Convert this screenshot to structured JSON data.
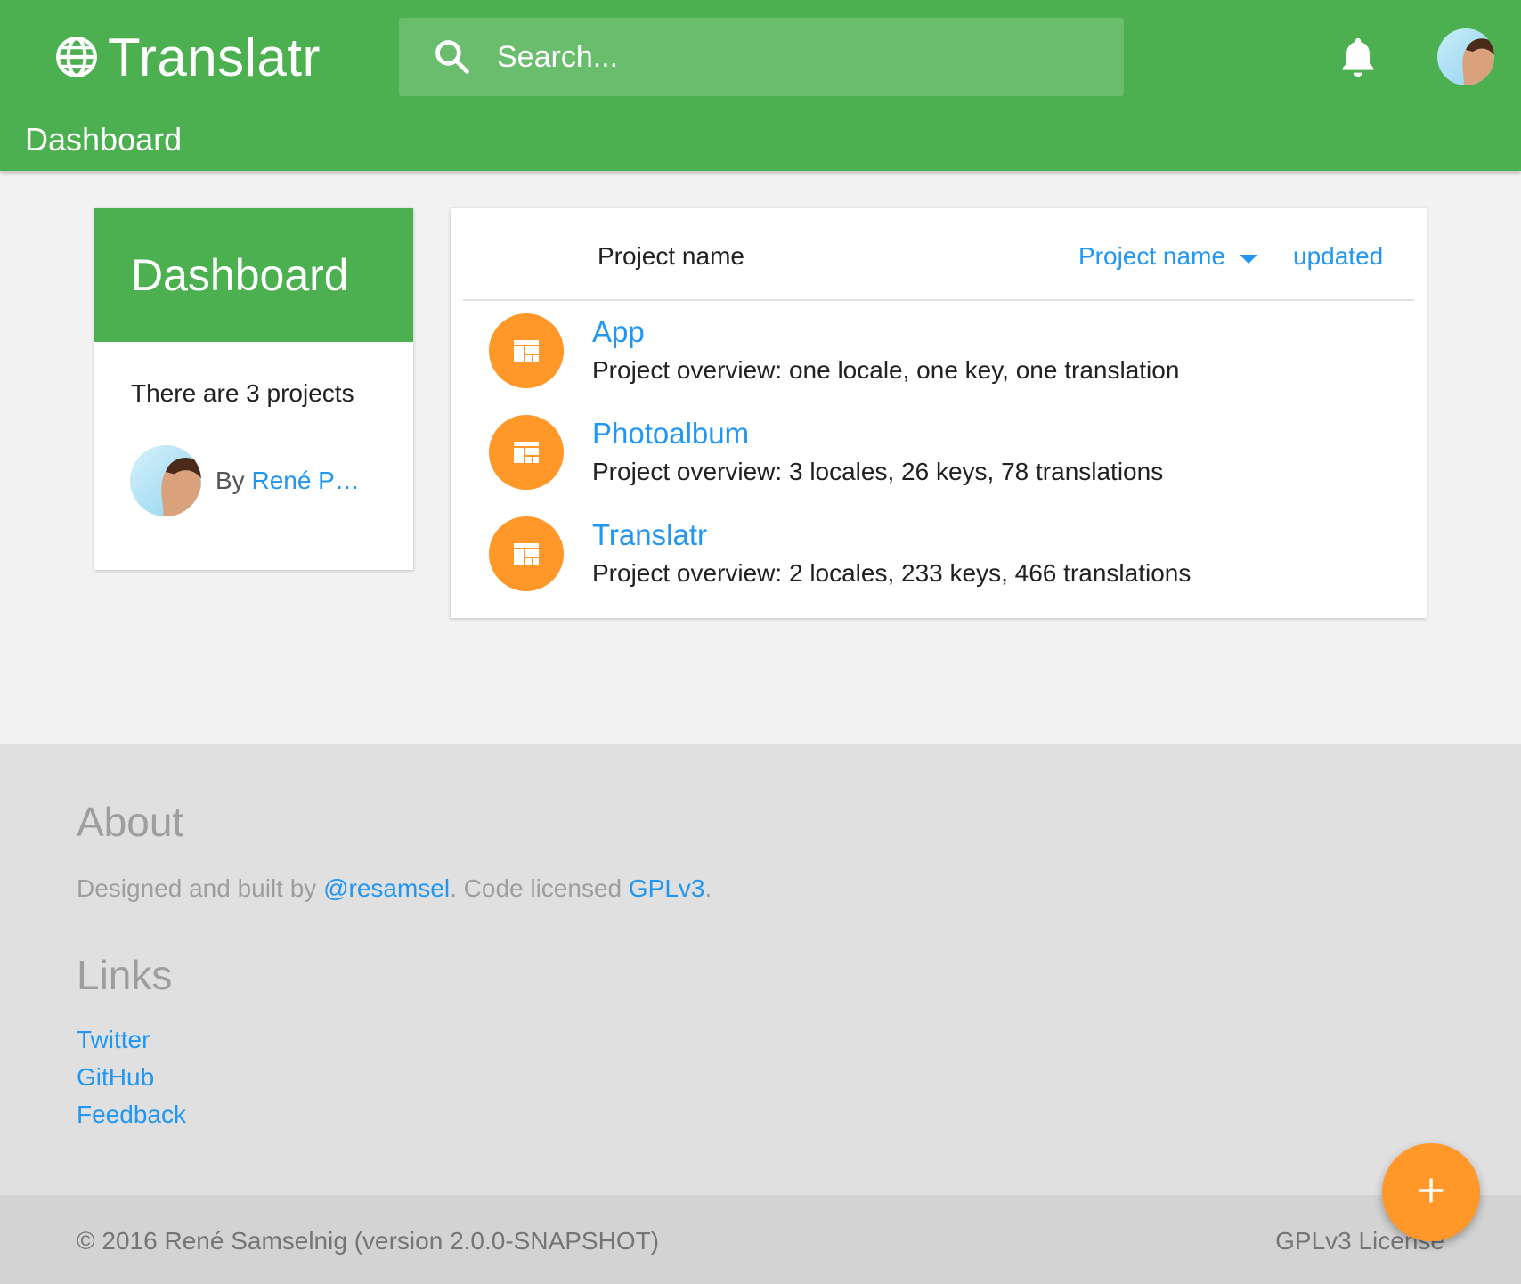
{
  "colors": {
    "primary": "#4caf50",
    "accent": "#ff9828",
    "link": "#2196f3"
  },
  "header": {
    "brand_icon": "globe-icon",
    "title": "Translatr",
    "search_placeholder": "Search...",
    "notifications_icon": "bell-icon",
    "subtitle": "Dashboard"
  },
  "dashboard_card": {
    "title": "Dashboard",
    "project_count_text": "There are 3 projects",
    "by_label": "By",
    "user_name": "René P…"
  },
  "project_list": {
    "column_title": "Project name",
    "sort_by_label": "Project name",
    "sort_updated_label": "updated",
    "projects": [
      {
        "name": "App",
        "overview": "Project overview: one locale, one key, one translation",
        "icon": "dashboard-icon"
      },
      {
        "name": "Photoalbum",
        "overview": "Project overview: 3 locales, 26 keys, 78 translations",
        "icon": "dashboard-icon"
      },
      {
        "name": "Translatr",
        "overview": "Project overview: 2 locales, 233 keys, 466 translations",
        "icon": "dashboard-icon"
      }
    ]
  },
  "footer": {
    "about_heading": "About",
    "about_prefix": "Designed and built by ",
    "about_author": "@resamsel",
    "about_mid": ". Code licensed ",
    "about_license": "GPLv3",
    "about_suffix": ".",
    "links_heading": "Links",
    "links": [
      "Twitter",
      "GitHub",
      "Feedback"
    ],
    "copyright": "© 2016 René Samselnig (version 2.0.0-SNAPSHOT)",
    "license": "GPLv3 License"
  },
  "fab": {
    "icon": "plus-icon"
  }
}
